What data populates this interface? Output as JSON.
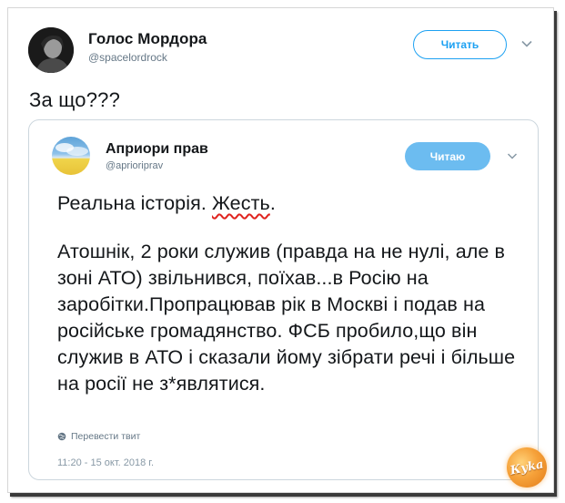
{
  "tweet": {
    "author_name": "Голос Мордора",
    "author_handle": "@spacelordrock",
    "follow_label": "Читать",
    "text": "За що???"
  },
  "quoted_tweet": {
    "author_name": "Априори прав",
    "author_handle": "@aprioriprav",
    "follow_label": "Читаю",
    "line1_before": "Реальна історія. ",
    "line1_typo": "Жесть",
    "line1_after": ".",
    "body": "Атошнік, 2 роки служив (правда на не нулі, але в зоні АТО) звільнився, поїхав...в Росію на заробітки.Пропрацював рік в Москві і подав на російське громадянство. ФСБ пробило,що він служив в АТО і сказали йому зібрати речі і більше на росії не з*являтися.",
    "translate_label": "Перевести твит",
    "timestamp": "11:20 - 15 окт. 2018 г."
  },
  "watermark": {
    "text": "Куka"
  },
  "icons": {
    "follow_more": "chevron-down-icon",
    "quote_more": "chevron-down-icon",
    "translate": "globe-icon"
  },
  "colors": {
    "accent": "#1da1f2",
    "following_button": "#6cbcf0",
    "muted_text": "#657786",
    "spellcheck_underline": "#e0241f"
  }
}
